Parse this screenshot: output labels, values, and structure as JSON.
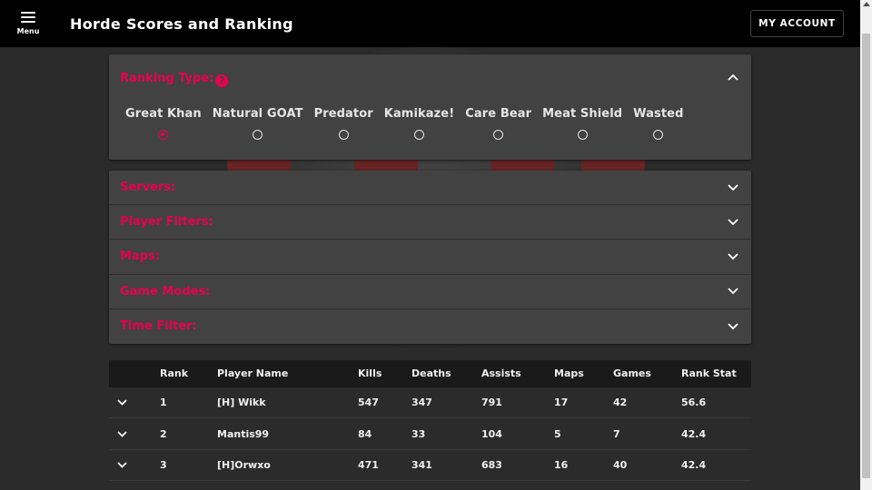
{
  "header": {
    "menu_label": "Menu",
    "title": "Horde Scores and Ranking",
    "account_button": "MY ACCOUNT"
  },
  "ranking_type": {
    "label": "Ranking Type:",
    "help_icon": "?",
    "options": [
      {
        "label": "Great Khan",
        "selected": true
      },
      {
        "label": "Natural GOAT",
        "selected": false
      },
      {
        "label": "Predator",
        "selected": false
      },
      {
        "label": "Kamikaze!",
        "selected": false
      },
      {
        "label": "Care Bear",
        "selected": false
      },
      {
        "label": "Meat Shield",
        "selected": false
      },
      {
        "label": "Wasted",
        "selected": false
      }
    ]
  },
  "filters": [
    {
      "label": "Servers:"
    },
    {
      "label": "Player Filters:"
    },
    {
      "label": "Maps:"
    },
    {
      "label": "Game Modes:"
    },
    {
      "label": "Time Filter:"
    }
  ],
  "table": {
    "columns": [
      "",
      "Rank",
      "Player Name",
      "Kills",
      "Deaths",
      "Assists",
      "Maps",
      "Games",
      "Rank Stat"
    ],
    "rows": [
      {
        "rank": "1",
        "name": "[H] Wikk",
        "kills": "547",
        "deaths": "347",
        "assists": "791",
        "maps": "17",
        "games": "42",
        "stat": "56.6"
      },
      {
        "rank": "2",
        "name": "Mantis99",
        "kills": "84",
        "deaths": "33",
        "assists": "104",
        "maps": "5",
        "games": "7",
        "stat": "42.4"
      },
      {
        "rank": "3",
        "name": "[H]Orwxo",
        "kills": "471",
        "deaths": "341",
        "assists": "683",
        "maps": "16",
        "games": "40",
        "stat": "42.4"
      }
    ]
  },
  "colors": {
    "accent": "#e8004f",
    "topbar": "#000000",
    "panel": "#424242",
    "background": "#2b2b2b"
  },
  "icons": {
    "menu": "hamburger-icon",
    "collapse": "chevron-up-icon",
    "expand": "chevron-down-icon",
    "help": "question-circle-icon"
  }
}
